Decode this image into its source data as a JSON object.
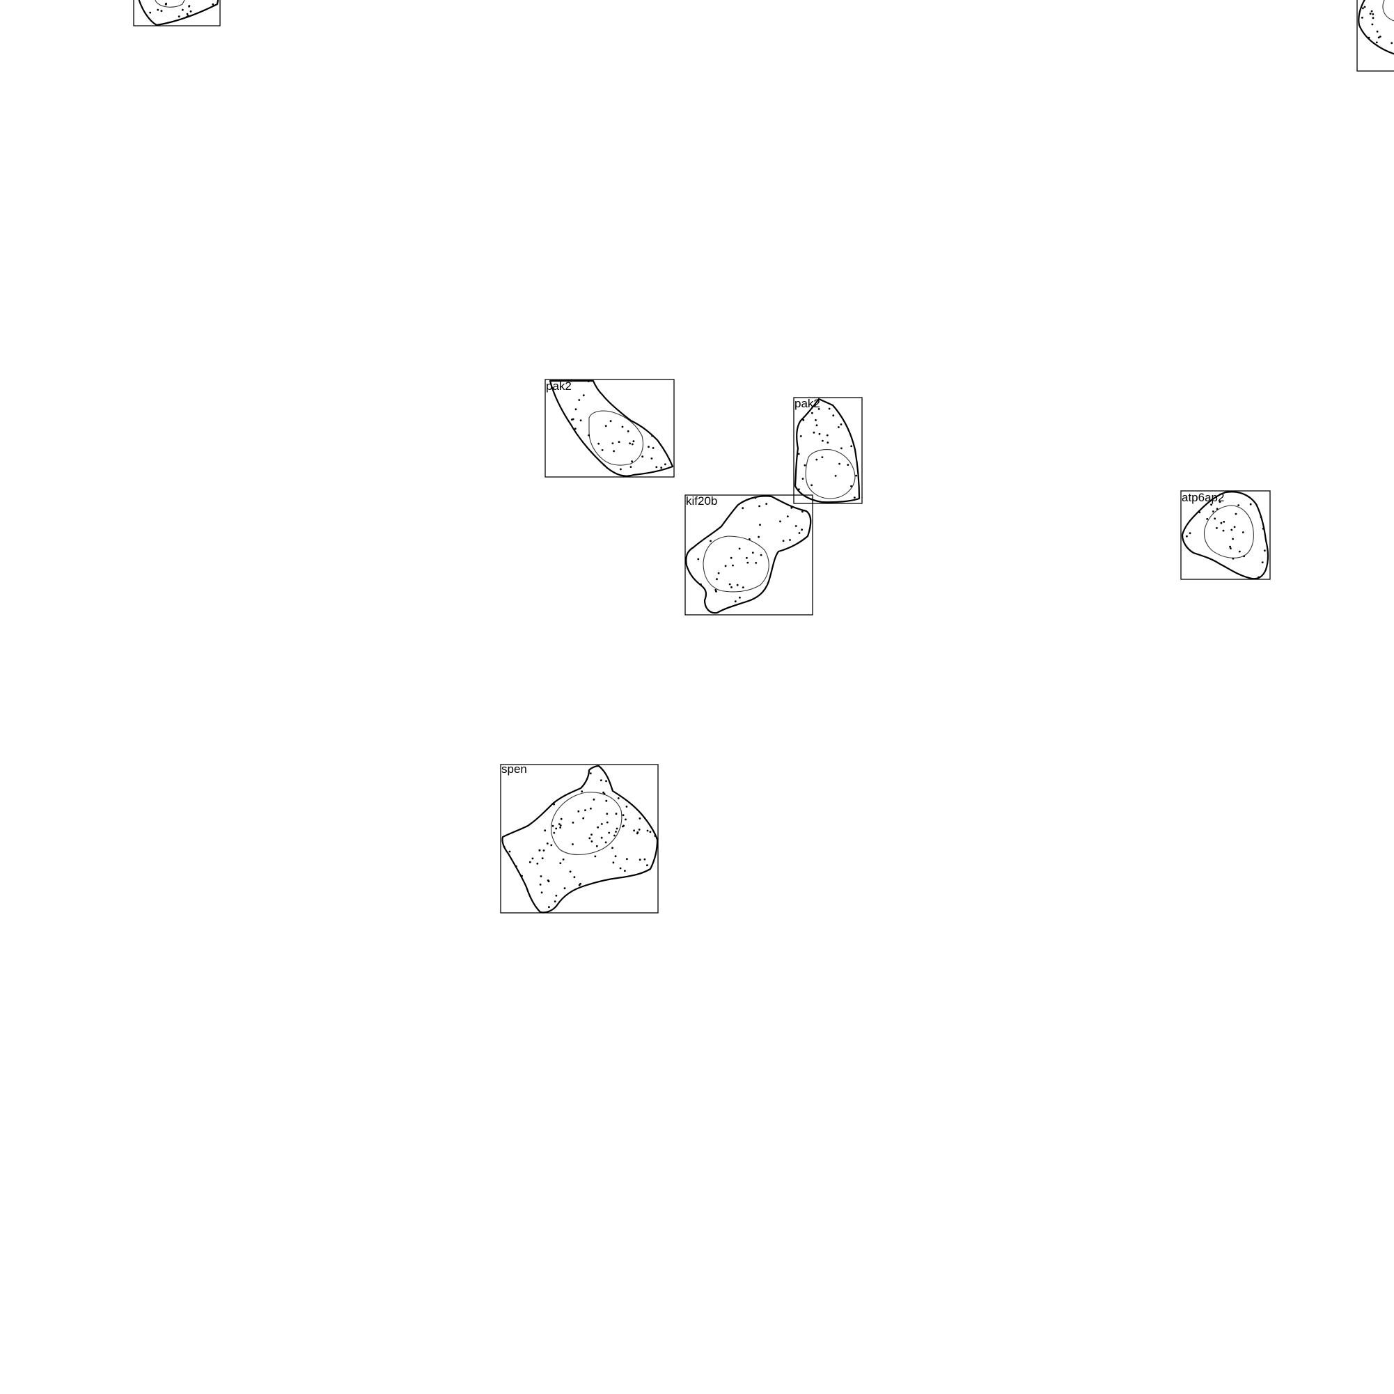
{
  "figure": {
    "background": "#ffffff",
    "cells": [
      {
        "label": "",
        "spots": 14
      },
      {
        "label": "",
        "spots": 14
      },
      {
        "label": "pak2",
        "spots": 34
      },
      {
        "label": "pak2",
        "spots": 30
      },
      {
        "label": "kif20b",
        "spots": 38
      },
      {
        "label": "atp6ap2",
        "spots": 30
      },
      {
        "label": "spen",
        "spots": 90
      }
    ]
  }
}
